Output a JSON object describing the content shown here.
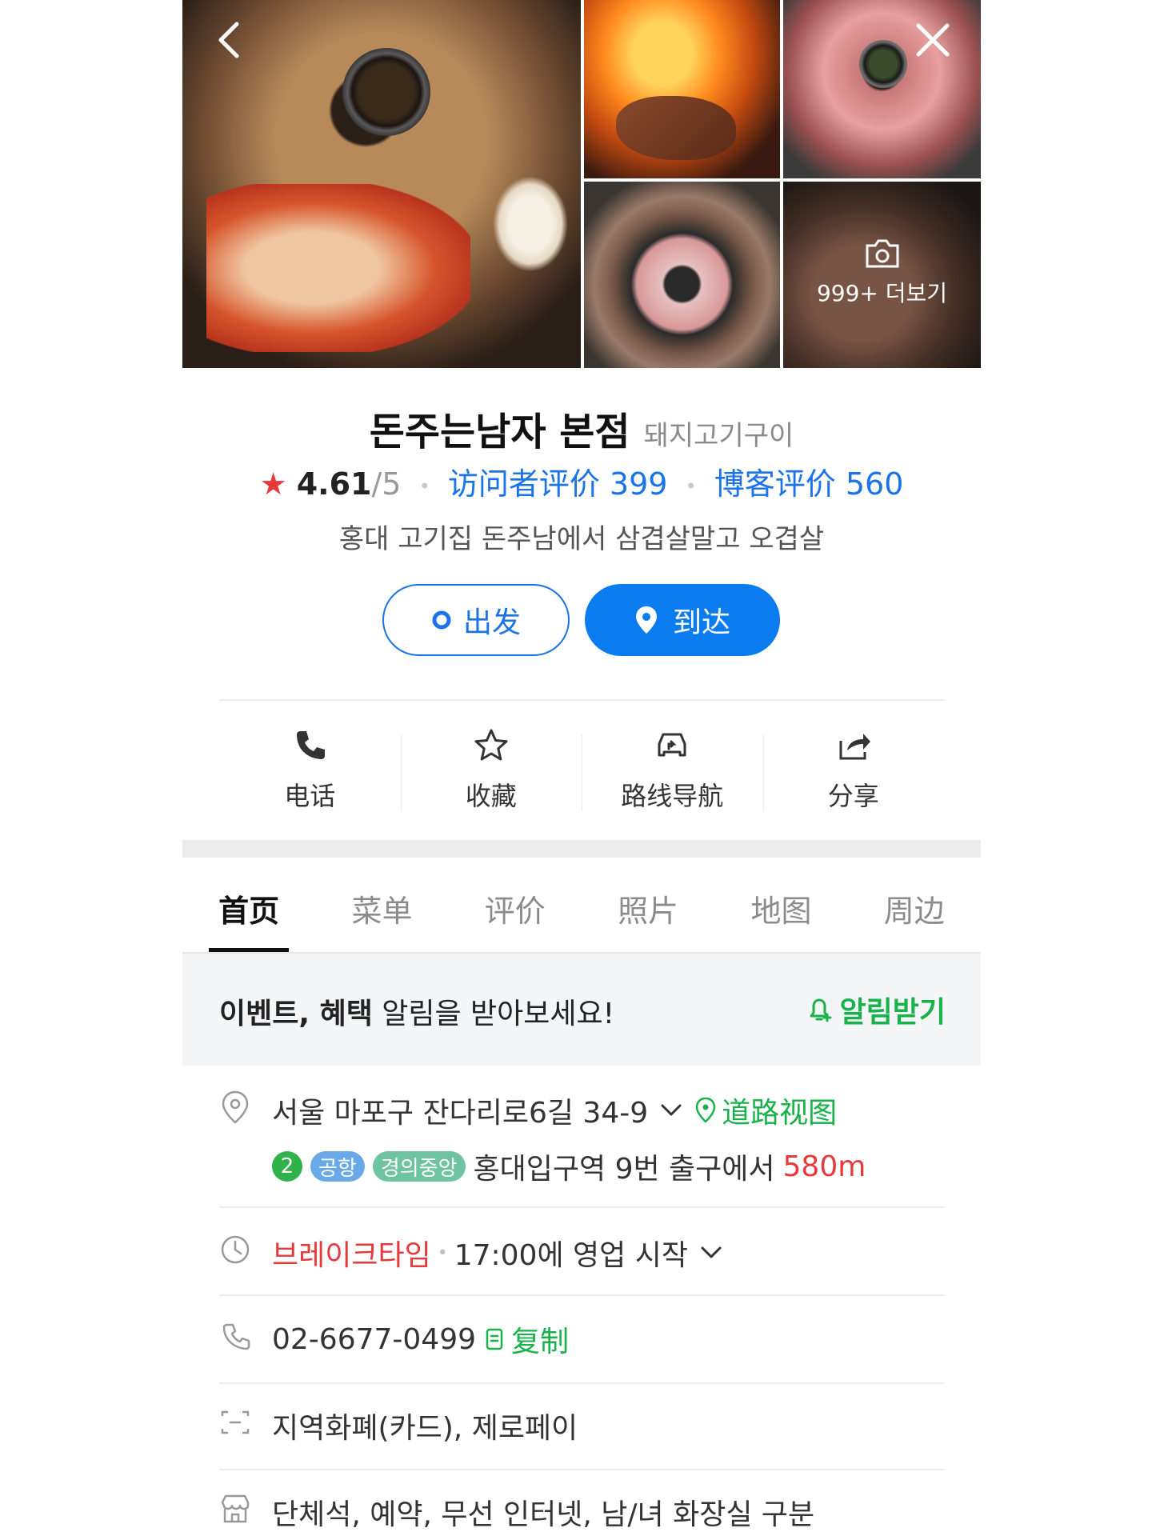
{
  "gallery": {
    "more_label": "999+ 더보기"
  },
  "header": {
    "name": "돈주는남자 본점",
    "category": "돼지고기구이",
    "rating": "4.61",
    "rating_max": "/5",
    "visitor_reviews": "访问者评价 399",
    "blog_reviews": "博客评价 560",
    "description": "홍대 고기집 돈주남에서 삼겹살말고 오겹살"
  },
  "route": {
    "depart_label": "出发",
    "arrive_label": "到达"
  },
  "actions": [
    {
      "label": "电话",
      "icon": "phone-icon"
    },
    {
      "label": "收藏",
      "icon": "star-icon"
    },
    {
      "label": "路线导航",
      "icon": "car-navigation-icon"
    },
    {
      "label": "分享",
      "icon": "share-icon"
    }
  ],
  "tabs": [
    {
      "label": "首页",
      "active": true
    },
    {
      "label": "菜单"
    },
    {
      "label": "评价"
    },
    {
      "label": "照片"
    },
    {
      "label": "地图"
    },
    {
      "label": "周边"
    }
  ],
  "notice": {
    "bold": "이벤트, 혜택",
    "text": " 알림을 받아보세요!",
    "action": "알림받기"
  },
  "info": {
    "address": "서울 마포구 잔다리로6길 34-9",
    "street_view": "道路视图",
    "subway_line": "2",
    "subway_airport": "공항",
    "subway_gyeongui": "경의중앙",
    "subway_text": "홍대입구역 9번 출구에서",
    "subway_distance": "580m",
    "hours_status": "브레이크타임",
    "hours_text": "17:00에 영업 시작",
    "phone": "02-6677-0499",
    "copy_label": "复制",
    "payment": "지역화폐(카드), 제로페이",
    "facilities": "단체석, 예약, 무선 인터넷, 남/녀 화장실 구분"
  },
  "colors": {
    "accent_blue": "#0a7cf0",
    "link_blue": "#1a73e8",
    "green": "#18b24a",
    "red": "#e5393c"
  }
}
